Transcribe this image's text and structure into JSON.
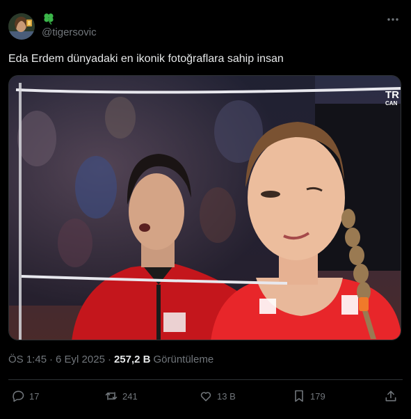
{
  "user": {
    "handle": "@tigersovic",
    "display_name_icon": "four-leaf-clover-icon",
    "badge_icon": "gold-badge-icon"
  },
  "tweet": {
    "text": "Eda Erdem dünyadaki en ikonik fotoğraflara sahip insan"
  },
  "media": {
    "logo_line1": "TR",
    "logo_line2": "CAN"
  },
  "meta": {
    "time": "ÖS 1:45",
    "separator": "·",
    "date": "6 Eyl 2025",
    "views_count": "257,2 B",
    "views_label": "Görüntüleme"
  },
  "actions": {
    "replies": "17",
    "reposts": "241",
    "likes": "13 B",
    "bookmarks": "179"
  },
  "colors": {
    "background": "#000000",
    "text": "#e7e9ea",
    "muted": "#71767b",
    "clover": "#3bb54a"
  }
}
